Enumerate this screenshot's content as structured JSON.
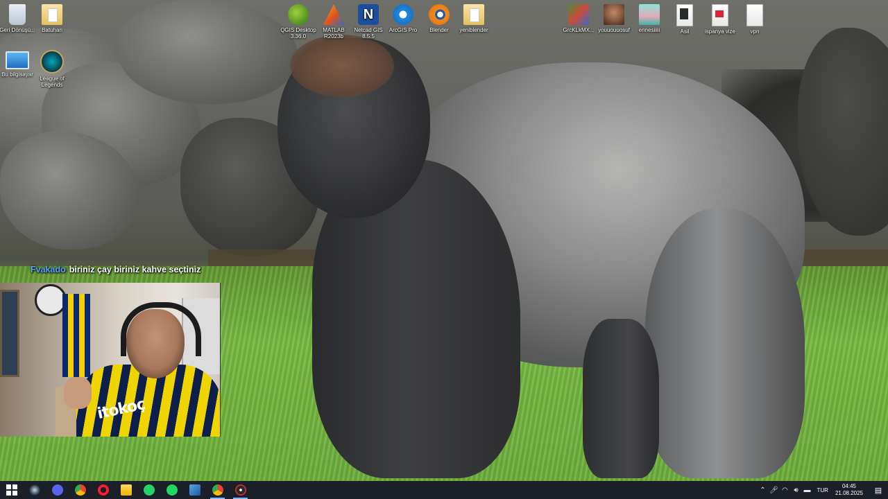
{
  "desktop": {
    "icons": [
      {
        "id": "recycle",
        "label": "Geri Dönüşü...",
        "icon": "recycle-bin-icon"
      },
      {
        "id": "batuhan",
        "label": "Batuhan",
        "icon": "folder-icon"
      },
      {
        "id": "pc",
        "label": "Bu bilgisayar",
        "icon": "computer-icon"
      },
      {
        "id": "lol",
        "label": "League of Legends",
        "icon": "league-of-legends-icon"
      },
      {
        "id": "qgis",
        "label": "QGIS Desktop 3.36.0",
        "icon": "qgis-icon"
      },
      {
        "id": "matlab",
        "label": "MATLAB R2023b",
        "icon": "matlab-icon"
      },
      {
        "id": "netcad",
        "label": "Netcad GIS 8.5.5",
        "icon": "netcad-icon"
      },
      {
        "id": "arcgis",
        "label": "ArcGIS Pro",
        "icon": "arcgis-icon"
      },
      {
        "id": "blender",
        "label": "Blender",
        "icon": "blender-icon"
      },
      {
        "id": "yeniblender",
        "label": "yeniblender",
        "icon": "folder-icon"
      },
      {
        "id": "grc",
        "label": "GrcKLkMX...",
        "icon": "image-file-icon"
      },
      {
        "id": "yousuf",
        "label": "youuouuosuf",
        "icon": "image-file-icon"
      },
      {
        "id": "ennes",
        "label": "ennesiiiii",
        "icon": "image-file-icon"
      },
      {
        "id": "asil",
        "label": "Asil",
        "icon": "folder-icon"
      },
      {
        "id": "ispanya",
        "label": "ispanya vize",
        "icon": "folder-icon"
      },
      {
        "id": "vpn",
        "label": "vpn",
        "icon": "folder-icon"
      }
    ]
  },
  "chat": {
    "user": "Fvakado",
    "message": "biriniz çay biriniz kahve seçtiniz"
  },
  "webcam": {
    "jersey_text": "itokoç"
  },
  "taskbar": {
    "apps": [
      {
        "id": "start",
        "icon": "windows-start-icon"
      },
      {
        "id": "steam",
        "icon": "steam-icon"
      },
      {
        "id": "discord",
        "icon": "discord-icon"
      },
      {
        "id": "chrome",
        "icon": "chrome-icon"
      },
      {
        "id": "opera",
        "icon": "opera-gx-icon"
      },
      {
        "id": "explorer",
        "icon": "file-explorer-icon"
      },
      {
        "id": "whatsapp",
        "icon": "whatsapp-icon"
      },
      {
        "id": "spotify",
        "icon": "spotify-icon"
      },
      {
        "id": "netcad",
        "icon": "netcad-app-icon"
      },
      {
        "id": "chrome2",
        "icon": "chrome-icon",
        "active": true
      },
      {
        "id": "obs",
        "icon": "obs-icon",
        "active": true
      }
    ],
    "tray": {
      "language": "TUR",
      "time": "04:45",
      "date": "21.08.2025"
    }
  }
}
